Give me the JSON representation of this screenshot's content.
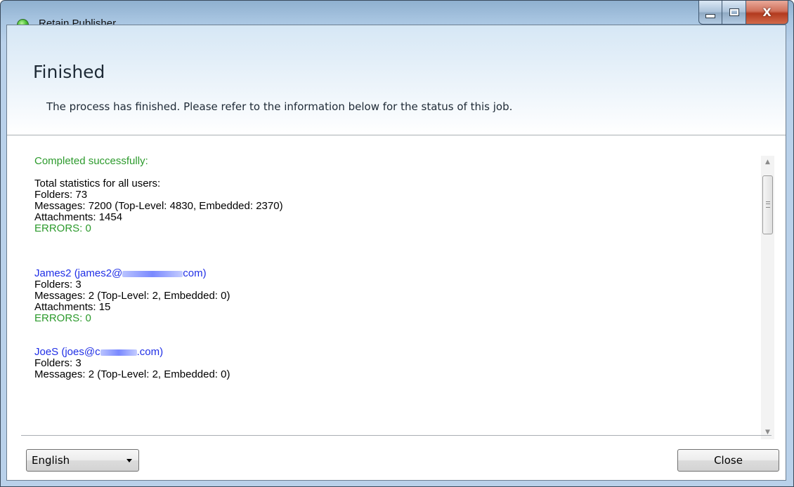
{
  "window": {
    "title": "Retain Publisher",
    "controls": [
      "minimize-icon",
      "maximize-icon",
      "close-icon"
    ],
    "close_glyph": "X"
  },
  "header": {
    "title": "Finished",
    "description": "The process has finished. Please refer to the information below for the status of this job."
  },
  "log": {
    "status": "Completed successfully:",
    "totals": {
      "heading": "Total statistics for all users:",
      "folders": "Folders: 73",
      "messages": "Messages: 7200 (Top-Level: 4830, Embedded: 2370)",
      "attachments": "Attachments: 1454",
      "errors": "ERRORS: 0"
    },
    "users": [
      {
        "name_prefix": "James2 (james2@",
        "name_suffix": "com)",
        "folders": "Folders: 3",
        "messages": "Messages: 2 (Top-Level: 2, Embedded: 0)",
        "attachments": "Attachments: 15",
        "errors": "ERRORS: 0"
      },
      {
        "name_prefix": "JoeS (joes@c",
        "name_suffix": ".com)",
        "folders": "Folders: 3",
        "messages": "Messages: 2 (Top-Level: 2, Embedded: 0)"
      }
    ]
  },
  "scrollbar": {
    "up_arrow": "▲",
    "down_arrow": "▼"
  },
  "footer": {
    "language_selected": "English",
    "close_label": "Close"
  },
  "colors": {
    "success_green": "#2c9a2c",
    "user_blue": "#1f2ee6"
  }
}
